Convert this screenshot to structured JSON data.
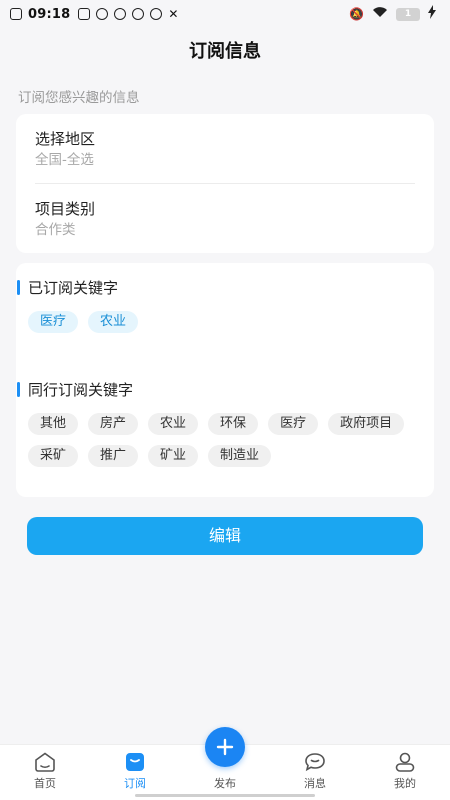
{
  "status_bar": {
    "time": "09:18",
    "battery": "1"
  },
  "header": {
    "title": "订阅信息"
  },
  "hint": "订阅您感兴趣的信息",
  "region": {
    "label": "选择地区",
    "value": "全国-全选"
  },
  "category": {
    "label": "项目类别",
    "value": "合作类"
  },
  "subscribed": {
    "title": "已订阅关键字",
    "tags": [
      "医疗",
      "农业"
    ]
  },
  "peer": {
    "title": "同行订阅关键字",
    "tags": [
      "其他",
      "房产",
      "农业",
      "环保",
      "医疗",
      "政府项目",
      "采矿",
      "推广",
      "矿业",
      "制造业"
    ]
  },
  "edit_button": "编辑",
  "tabs": [
    {
      "label": "首页",
      "icon": "home-icon"
    },
    {
      "label": "订阅",
      "icon": "subscribe-icon"
    },
    {
      "label": "发布",
      "icon": "plus-icon"
    },
    {
      "label": "消息",
      "icon": "message-icon"
    },
    {
      "label": "我的",
      "icon": "profile-icon"
    }
  ],
  "colors": {
    "accent": "#1c8ff5",
    "button": "#1ba6f1",
    "tag_bg": "#e5f5fd"
  }
}
